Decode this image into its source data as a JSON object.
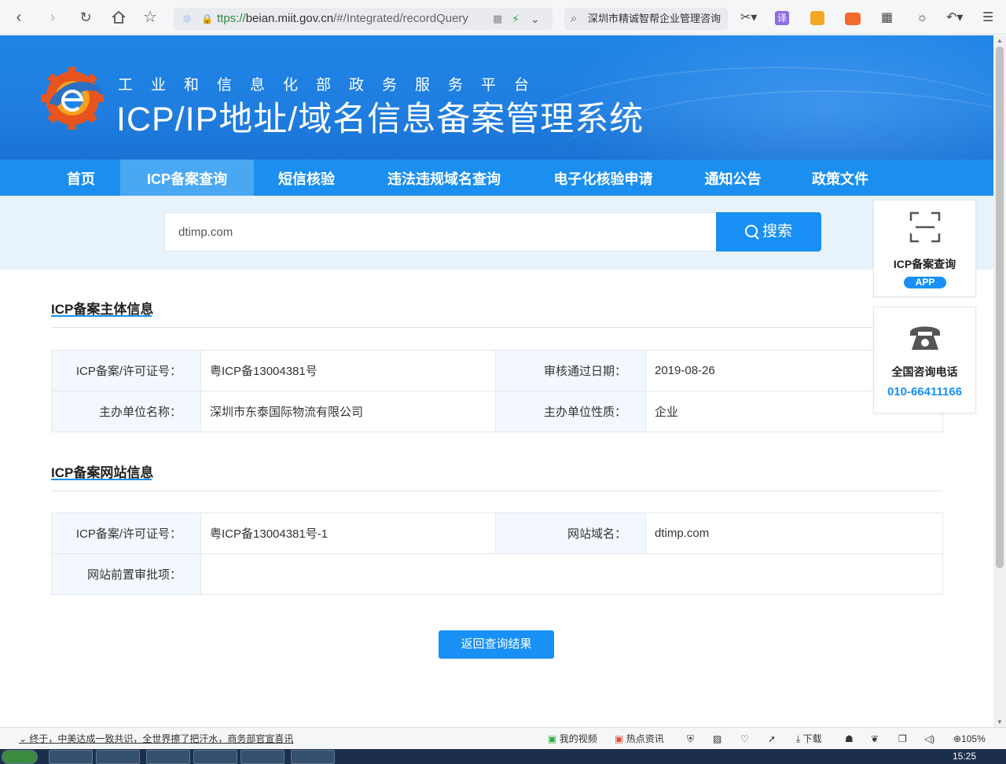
{
  "browser": {
    "url_prefix": "ttps://",
    "url_host": "beian.miit.gov.cn",
    "url_path": "/#/Integrated/recordQuery",
    "search_text": "深圳市精诚智帮企业管理咨询",
    "translate_label": "译"
  },
  "header": {
    "sup_title": "工业和信息化部政务服务平台",
    "main_title": "ICP/IP地址/域名信息备案管理系统"
  },
  "nav": {
    "items": [
      "首页",
      "ICP备案查询",
      "短信核验",
      "违法违规域名查询",
      "电子化核验申请",
      "通知公告",
      "政策文件"
    ],
    "active": "ICP备案查询"
  },
  "search": {
    "value": "dtimp.com",
    "button_label": "搜索"
  },
  "subject_section": {
    "title": "ICP备案主体信息",
    "rows": [
      {
        "label1": "ICP备案/许可证号：",
        "value1": "粤ICP备13004381号",
        "label2": "审核通过日期：",
        "value2": "2019-08-26"
      },
      {
        "label1": "主办单位名称：",
        "value1": "深圳市东泰国际物流有限公司",
        "label2": "主办单位性质：",
        "value2": "企业"
      }
    ]
  },
  "website_section": {
    "title": "ICP备案网站信息",
    "rows": [
      {
        "label1": "ICP备案/许可证号：",
        "value1": "粤ICP备13004381号-1",
        "label2": "网站域名：",
        "value2": "dtimp.com"
      },
      {
        "label1": "网站前置审批项：",
        "value1": ""
      }
    ]
  },
  "back_button": "返回查询结果",
  "floating": {
    "app_title": "ICP备案查询",
    "app_badge": "APP",
    "phone_title": "全国咨询电话",
    "phone_number": "010-66411166"
  },
  "status_bar": {
    "news": "终于，中美达成一致共识，全世界擦了把汗水，商务部官宣喜讯",
    "my_video": "我的视频",
    "hot_news": "热点资讯",
    "download": "下载",
    "zoom": "105%"
  },
  "taskbar": {
    "time": "15:25"
  },
  "colors": {
    "brand_blue": "#1890f5",
    "nav_blue": "#1a8fef",
    "nav_active": "#4aa8f3",
    "banner_blue": "#1e84e6",
    "label_bg": "#f2f8fd"
  }
}
